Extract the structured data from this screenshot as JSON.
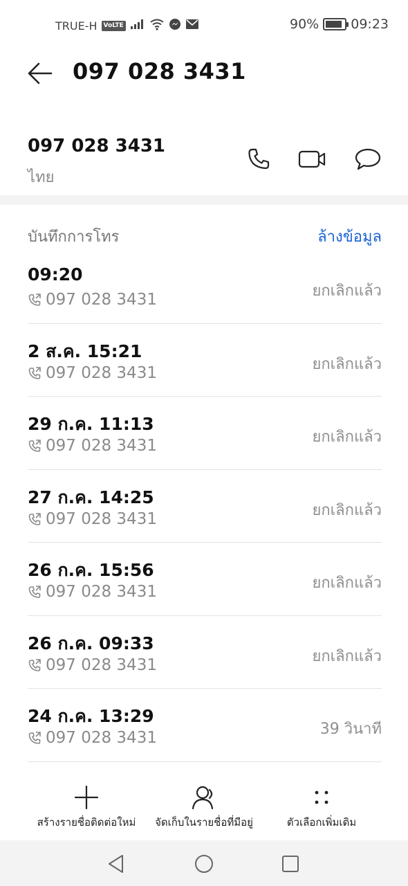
{
  "status_bar": {
    "carrier": "TRUE-H",
    "volte": "VoLTE",
    "battery_text": "90%",
    "battery_level": 0.9,
    "time": "09:23"
  },
  "header": {
    "title": "097 028 3431"
  },
  "contact": {
    "number": "097 028 3431",
    "region": "ไทย"
  },
  "call_log": {
    "title": "บันทึกการโทร",
    "clear_label": "ล้างข้อมูล",
    "entries": [
      {
        "time": "09:20",
        "number": "097 028 3431",
        "status": "ยกเลิกแล้ว"
      },
      {
        "time": "2 ส.ค. 15:21",
        "number": "097 028 3431",
        "status": "ยกเลิกแล้ว"
      },
      {
        "time": "29 ก.ค. 11:13",
        "number": "097 028 3431",
        "status": "ยกเลิกแล้ว"
      },
      {
        "time": "27 ก.ค. 14:25",
        "number": "097 028 3431",
        "status": "ยกเลิกแล้ว"
      },
      {
        "time": "26 ก.ค. 15:56",
        "number": "097 028 3431",
        "status": "ยกเลิกแล้ว"
      },
      {
        "time": "26 ก.ค. 09:33",
        "number": "097 028 3431",
        "status": "ยกเลิกแล้ว"
      },
      {
        "time": "24 ก.ค. 13:29",
        "number": "097 028 3431",
        "status": "39 วินาที"
      }
    ]
  },
  "toolbar": {
    "new_contact": "สร้างรายชื่อติดต่อใหม่",
    "save_existing": "จัดเก็บในรายชื่อที่มีอยู่",
    "more_options": "ตัวเลือกเพิ่มเติม"
  },
  "colors": {
    "accent": "#1a63d6",
    "secondary_text": "#8a8a8a"
  },
  "icons": {
    "back": "arrow-left-icon",
    "call": "phone-icon",
    "video": "video-camera-icon",
    "message": "chat-bubble-icon",
    "call_type": "outgoing-call-icon",
    "new_contact": "plus-icon",
    "save_existing": "person-icon",
    "more": "more-dots-icon"
  }
}
